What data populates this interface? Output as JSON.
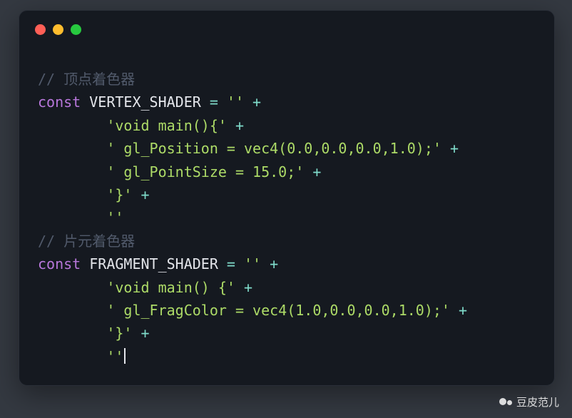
{
  "code": {
    "c1": "// 顶点着色器",
    "kw1": "const",
    "id1": " VERTEX_SHADER ",
    "op1": "=",
    "s1": " ''",
    "plus": " +",
    "s2": "        'void main(){'",
    "s3": "        ' gl_Position = vec4(0.0,0.0,0.0,1.0);'",
    "s4": "        ' gl_PointSize = 15.0;'",
    "s5": "        '}'",
    "s6": "        ''",
    "c2": "// 片元着色器",
    "kw2": "const",
    "id2": " FRAGMENT_SHADER ",
    "op2": "=",
    "s7": " ''",
    "s8": "        'void main() {'",
    "s9": "        ' gl_FragColor = vec4(1.0,0.0,0.0,1.0);'",
    "s10": "        '}'",
    "s11": "        ''"
  },
  "watermark": {
    "label": "豆皮范儿"
  }
}
